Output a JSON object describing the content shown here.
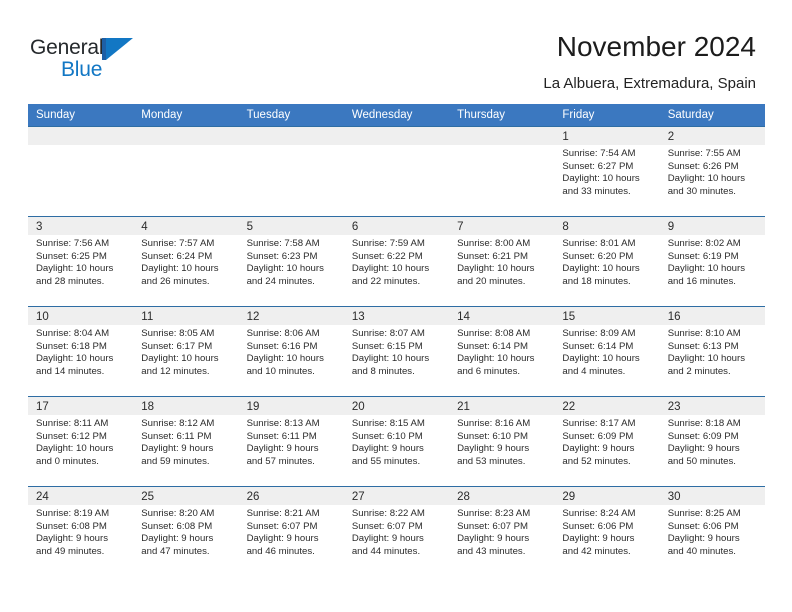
{
  "brand": {
    "name_part1": "General",
    "name_part2": "Blue",
    "logo_icon": "flag-triangle-icon",
    "accent_color": "#1277c4"
  },
  "header": {
    "title": "November 2024",
    "subtitle": "La Albuera, Extremadura, Spain"
  },
  "theme": {
    "header_row_bg": "#3b78c0",
    "row_border": "#2e6da4",
    "day_band_bg": "#efefef",
    "text_color": "#2b2b2b"
  },
  "calendar": {
    "weekdays": [
      "Sunday",
      "Monday",
      "Tuesday",
      "Wednesday",
      "Thursday",
      "Friday",
      "Saturday"
    ],
    "labels": {
      "sunrise": "Sunrise:",
      "sunset": "Sunset:",
      "daylight": "Daylight:"
    },
    "weeks": [
      [
        {
          "day": "",
          "empty": true
        },
        {
          "day": "",
          "empty": true
        },
        {
          "day": "",
          "empty": true
        },
        {
          "day": "",
          "empty": true
        },
        {
          "day": "",
          "empty": true
        },
        {
          "day": "1",
          "sunrise": "Sunrise: 7:54 AM",
          "sunset": "Sunset: 6:27 PM",
          "daylight_1": "Daylight: 10 hours",
          "daylight_2": "and 33 minutes."
        },
        {
          "day": "2",
          "sunrise": "Sunrise: 7:55 AM",
          "sunset": "Sunset: 6:26 PM",
          "daylight_1": "Daylight: 10 hours",
          "daylight_2": "and 30 minutes."
        }
      ],
      [
        {
          "day": "3",
          "sunrise": "Sunrise: 7:56 AM",
          "sunset": "Sunset: 6:25 PM",
          "daylight_1": "Daylight: 10 hours",
          "daylight_2": "and 28 minutes."
        },
        {
          "day": "4",
          "sunrise": "Sunrise: 7:57 AM",
          "sunset": "Sunset: 6:24 PM",
          "daylight_1": "Daylight: 10 hours",
          "daylight_2": "and 26 minutes."
        },
        {
          "day": "5",
          "sunrise": "Sunrise: 7:58 AM",
          "sunset": "Sunset: 6:23 PM",
          "daylight_1": "Daylight: 10 hours",
          "daylight_2": "and 24 minutes."
        },
        {
          "day": "6",
          "sunrise": "Sunrise: 7:59 AM",
          "sunset": "Sunset: 6:22 PM",
          "daylight_1": "Daylight: 10 hours",
          "daylight_2": "and 22 minutes."
        },
        {
          "day": "7",
          "sunrise": "Sunrise: 8:00 AM",
          "sunset": "Sunset: 6:21 PM",
          "daylight_1": "Daylight: 10 hours",
          "daylight_2": "and 20 minutes."
        },
        {
          "day": "8",
          "sunrise": "Sunrise: 8:01 AM",
          "sunset": "Sunset: 6:20 PM",
          "daylight_1": "Daylight: 10 hours",
          "daylight_2": "and 18 minutes."
        },
        {
          "day": "9",
          "sunrise": "Sunrise: 8:02 AM",
          "sunset": "Sunset: 6:19 PM",
          "daylight_1": "Daylight: 10 hours",
          "daylight_2": "and 16 minutes."
        }
      ],
      [
        {
          "day": "10",
          "sunrise": "Sunrise: 8:04 AM",
          "sunset": "Sunset: 6:18 PM",
          "daylight_1": "Daylight: 10 hours",
          "daylight_2": "and 14 minutes."
        },
        {
          "day": "11",
          "sunrise": "Sunrise: 8:05 AM",
          "sunset": "Sunset: 6:17 PM",
          "daylight_1": "Daylight: 10 hours",
          "daylight_2": "and 12 minutes."
        },
        {
          "day": "12",
          "sunrise": "Sunrise: 8:06 AM",
          "sunset": "Sunset: 6:16 PM",
          "daylight_1": "Daylight: 10 hours",
          "daylight_2": "and 10 minutes."
        },
        {
          "day": "13",
          "sunrise": "Sunrise: 8:07 AM",
          "sunset": "Sunset: 6:15 PM",
          "daylight_1": "Daylight: 10 hours",
          "daylight_2": "and 8 minutes."
        },
        {
          "day": "14",
          "sunrise": "Sunrise: 8:08 AM",
          "sunset": "Sunset: 6:14 PM",
          "daylight_1": "Daylight: 10 hours",
          "daylight_2": "and 6 minutes."
        },
        {
          "day": "15",
          "sunrise": "Sunrise: 8:09 AM",
          "sunset": "Sunset: 6:14 PM",
          "daylight_1": "Daylight: 10 hours",
          "daylight_2": "and 4 minutes."
        },
        {
          "day": "16",
          "sunrise": "Sunrise: 8:10 AM",
          "sunset": "Sunset: 6:13 PM",
          "daylight_1": "Daylight: 10 hours",
          "daylight_2": "and 2 minutes."
        }
      ],
      [
        {
          "day": "17",
          "sunrise": "Sunrise: 8:11 AM",
          "sunset": "Sunset: 6:12 PM",
          "daylight_1": "Daylight: 10 hours",
          "daylight_2": "and 0 minutes."
        },
        {
          "day": "18",
          "sunrise": "Sunrise: 8:12 AM",
          "sunset": "Sunset: 6:11 PM",
          "daylight_1": "Daylight: 9 hours",
          "daylight_2": "and 59 minutes."
        },
        {
          "day": "19",
          "sunrise": "Sunrise: 8:13 AM",
          "sunset": "Sunset: 6:11 PM",
          "daylight_1": "Daylight: 9 hours",
          "daylight_2": "and 57 minutes."
        },
        {
          "day": "20",
          "sunrise": "Sunrise: 8:15 AM",
          "sunset": "Sunset: 6:10 PM",
          "daylight_1": "Daylight: 9 hours",
          "daylight_2": "and 55 minutes."
        },
        {
          "day": "21",
          "sunrise": "Sunrise: 8:16 AM",
          "sunset": "Sunset: 6:10 PM",
          "daylight_1": "Daylight: 9 hours",
          "daylight_2": "and 53 minutes."
        },
        {
          "day": "22",
          "sunrise": "Sunrise: 8:17 AM",
          "sunset": "Sunset: 6:09 PM",
          "daylight_1": "Daylight: 9 hours",
          "daylight_2": "and 52 minutes."
        },
        {
          "day": "23",
          "sunrise": "Sunrise: 8:18 AM",
          "sunset": "Sunset: 6:09 PM",
          "daylight_1": "Daylight: 9 hours",
          "daylight_2": "and 50 minutes."
        }
      ],
      [
        {
          "day": "24",
          "sunrise": "Sunrise: 8:19 AM",
          "sunset": "Sunset: 6:08 PM",
          "daylight_1": "Daylight: 9 hours",
          "daylight_2": "and 49 minutes."
        },
        {
          "day": "25",
          "sunrise": "Sunrise: 8:20 AM",
          "sunset": "Sunset: 6:08 PM",
          "daylight_1": "Daylight: 9 hours",
          "daylight_2": "and 47 minutes."
        },
        {
          "day": "26",
          "sunrise": "Sunrise: 8:21 AM",
          "sunset": "Sunset: 6:07 PM",
          "daylight_1": "Daylight: 9 hours",
          "daylight_2": "and 46 minutes."
        },
        {
          "day": "27",
          "sunrise": "Sunrise: 8:22 AM",
          "sunset": "Sunset: 6:07 PM",
          "daylight_1": "Daylight: 9 hours",
          "daylight_2": "and 44 minutes."
        },
        {
          "day": "28",
          "sunrise": "Sunrise: 8:23 AM",
          "sunset": "Sunset: 6:07 PM",
          "daylight_1": "Daylight: 9 hours",
          "daylight_2": "and 43 minutes."
        },
        {
          "day": "29",
          "sunrise": "Sunrise: 8:24 AM",
          "sunset": "Sunset: 6:06 PM",
          "daylight_1": "Daylight: 9 hours",
          "daylight_2": "and 42 minutes."
        },
        {
          "day": "30",
          "sunrise": "Sunrise: 8:25 AM",
          "sunset": "Sunset: 6:06 PM",
          "daylight_1": "Daylight: 9 hours",
          "daylight_2": "and 40 minutes."
        }
      ]
    ]
  }
}
